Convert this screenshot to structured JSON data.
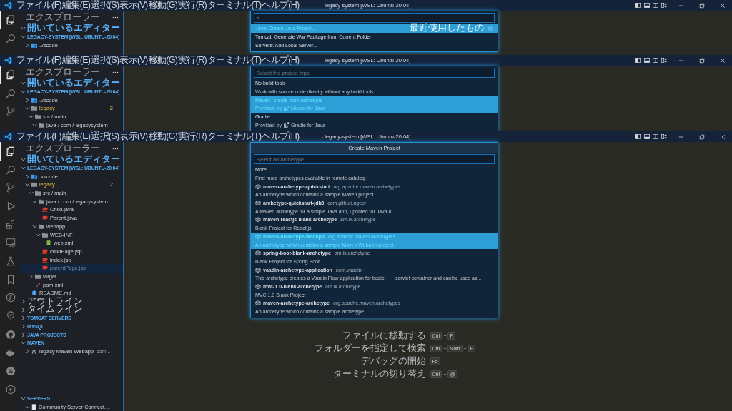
{
  "windows": [
    {
      "title": "- legacy-system [WSL: Ubuntu-20.04]",
      "menu": [
        "ファイル(F)",
        "編集(E)",
        "選択(S)",
        "表示(V)",
        "移動(G)",
        "実行(R)",
        "ターミナル(T)",
        "ヘルプ(H)"
      ],
      "explorer_title": "エクスプローラー",
      "sections": [
        {
          "title": "開いているエディター",
          "kind": "editors",
          "expanded": true
        },
        {
          "title": "LEGACY-SYSTEM [WSL: UBUNTU-20.04]",
          "kind": "workspace",
          "expanded": true,
          "items": [
            {
              "label": ".vscode",
              "kind": "vscode-folder",
              "expanded": false,
              "selected": false
            }
          ]
        }
      ],
      "quick_pick": {
        "value": ">",
        "items": [
          {
            "kind": "command",
            "label": "Java: Create Java Project...",
            "tag": "最近使用したもの",
            "selected": true
          },
          {
            "kind": "command",
            "label": "Tomcat: Generate War Package from Current Folder",
            "selected": false
          },
          {
            "kind": "command",
            "label": "Servers: Add Local Server...",
            "selected": false
          }
        ]
      }
    },
    {
      "title": "- legacy-system [WSL: Ubuntu-20.04]",
      "menu": [
        "ファイル(F)",
        "編集(E)",
        "選択(S)",
        "表示(V)",
        "移動(G)",
        "実行(R)",
        "ターミナル(T)",
        "ヘルプ(H)"
      ],
      "explorer_title": "エクスプローラー",
      "sections": [
        {
          "title": "開いているエディター",
          "kind": "editors",
          "expanded": true
        },
        {
          "title": "LEGACY-SYSTEM [WSL: UBUNTU-20.04]",
          "kind": "workspace",
          "expanded": true,
          "items": [
            {
              "label": ".vscode",
              "kind": "vscode-folder",
              "expanded": false,
              "selected": false
            },
            {
              "label": "legacy",
              "kind": "folder",
              "expanded": true,
              "selected": false,
              "badge": "2",
              "children": [
                {
                  "label": "src / main",
                  "kind": "folder",
                  "expanded": true,
                  "selected": false,
                  "children": [
                    {
                      "label": "java / com / legacysystem",
                      "kind": "folder",
                      "expanded": true,
                      "selected": false
                    }
                  ]
                }
              ]
            }
          ]
        }
      ],
      "quick_pick": {
        "placeholder": "Select the project type",
        "items": [
          {
            "kind": "option",
            "label": "No build tools",
            "detail": "Work with source code directly without any build tools",
            "selected": false
          },
          {
            "kind": "option",
            "label": "Maven",
            "description": "create from archetype",
            "detail": "Provided by",
            "provider": "Maven for Java",
            "selected": true
          },
          {
            "kind": "option",
            "label": "Gradle",
            "detail": "Provided by",
            "provider": "Gradle for Java",
            "selected": false
          }
        ]
      }
    },
    {
      "title": "- legacy-system [WSL: Ubuntu-20.04]",
      "menu": [
        "ファイル(F)",
        "編集(E)",
        "選択(S)",
        "表示(V)",
        "移動(G)",
        "実行(R)",
        "ターミナル(T)",
        "ヘルプ(H)"
      ],
      "explorer_title": "エクスプローラー",
      "sections": [
        {
          "title": "開いているエディター",
          "kind": "editors",
          "expanded": true
        },
        {
          "title": "LEGACY-SYSTEM [WSL: UBUNTU-20.04]",
          "kind": "workspace",
          "expanded": true,
          "items": [
            {
              "label": ".vscode",
              "kind": "vscode-folder",
              "expanded": false,
              "selected": false
            },
            {
              "label": "legacy",
              "kind": "folder",
              "expanded": true,
              "selected": false,
              "badge": "2",
              "children": [
                {
                  "label": "src / main",
                  "kind": "folder",
                  "expanded": true,
                  "selected": false,
                  "children": [
                    {
                      "label": "java / com / legacysystem",
                      "kind": "folder",
                      "expanded": true,
                      "selected": false,
                      "children": [
                        {
                          "label": "Child.java",
                          "kind": "java",
                          "selected": false
                        },
                        {
                          "label": "Parent.java",
                          "kind": "java",
                          "selected": false
                        }
                      ]
                    },
                    {
                      "label": "webapp",
                      "kind": "folder",
                      "expanded": true,
                      "selected": false,
                      "children": [
                        {
                          "label": "WEB-INF",
                          "kind": "folder",
                          "expanded": true,
                          "selected": false,
                          "children": [
                            {
                              "label": "web.xml",
                              "kind": "xml",
                              "selected": false
                            }
                          ]
                        },
                        {
                          "label": "childPage.jsp",
                          "kind": "java",
                          "selected": false
                        },
                        {
                          "label": "index.jsp",
                          "kind": "java",
                          "selected": false
                        },
                        {
                          "label": "parentPage.jsp",
                          "kind": "java",
                          "selected": true
                        }
                      ]
                    }
                  ]
                },
                {
                  "label": "target",
                  "kind": "folder",
                  "expanded": false,
                  "selected": false
                },
                {
                  "label": "pom.xml",
                  "kind": "pom",
                  "selected": false
                }
              ]
            },
            {
              "label": "README.md",
              "kind": "info",
              "selected": false
            }
          ]
        },
        {
          "title": "アウトライン",
          "kind": "builtin",
          "expanded": false
        },
        {
          "title": "タイムライン",
          "kind": "builtin",
          "expanded": false
        },
        {
          "title": "TOMCAT SERVERS",
          "kind": "extension",
          "expanded": false
        },
        {
          "title": "MYSQL",
          "kind": "extension",
          "expanded": false
        },
        {
          "title": "JAVA PROJECTS",
          "kind": "extension",
          "expanded": false
        },
        {
          "title": "MAVEN",
          "kind": "extension",
          "expanded": true,
          "items": [
            {
              "label": "legacy Maven Webapp",
              "description": "com...",
              "kind": "maven",
              "expanded": false,
              "selected": false
            }
          ]
        },
        {
          "title": "SERVERS",
          "kind": "extension",
          "expanded": true,
          "items": [
            {
              "label": "Community Server Connect...",
              "kind": "server",
              "expanded": true,
              "selected": false
            }
          ]
        }
      ],
      "quick_pick": {
        "title": "Create Maven Project",
        "placeholder": "Select an archetype ...",
        "items": [
          {
            "kind": "more",
            "label": "More...",
            "detail": "Find more archetypes available in remote catalog.",
            "selected": false
          },
          {
            "kind": "archetype",
            "label": "maven-archetype-quickstart",
            "description": "org.apache.maven.archetypes",
            "detail": "An archetype which contains a sample Maven project.",
            "selected": false
          },
          {
            "kind": "archetype",
            "label": "archetype-quickstart-jdk8",
            "description": "com.github.ngeor",
            "detail": "A Maven archetype for a simple Java app, updated for Java 8",
            "selected": false
          },
          {
            "kind": "archetype",
            "label": "maven-reactjs-blank-archetype",
            "description": "am.ik.archetype",
            "detail": "Blank Project for React.js",
            "selected": false
          },
          {
            "kind": "archetype",
            "label": "maven-archetype-webapp",
            "description": "org.apache.maven.archetypes",
            "detail": "An archetype which contains a sample Maven Webapp project.",
            "selected": true
          },
          {
            "kind": "archetype",
            "label": "spring-boot-blank-archetype",
            "description": "am.ik.archetype",
            "detail": "Blank Project for Spring Boot",
            "selected": false
          },
          {
            "kind": "archetype",
            "label": "vaadin-archetype-application",
            "description": "com.vaadin",
            "detail": "This archetype creates a Vaadin Flow application for basic        servlet container and can be used as...",
            "selected": false
          },
          {
            "kind": "archetype",
            "label": "mvc-1.0-blank-archetype",
            "description": "am.ik.archetype",
            "detail": "MVC 1.0 Blank Project",
            "selected": false
          },
          {
            "kind": "archetype",
            "label": "maven-archetype-archetype",
            "description": "org.apache.maven.archetypes",
            "detail": "An archetype which contains a sample archetype.",
            "selected": false
          }
        ]
      },
      "hints": [
        {
          "label": "ファイルに移動する",
          "keys": [
            "Ctrl",
            "+",
            "P"
          ]
        },
        {
          "label": "フォルダーを指定して検索",
          "keys": [
            "Ctrl",
            "+",
            "Shift",
            "+",
            "F"
          ]
        },
        {
          "label": "デバッグの開始",
          "keys": [
            "F5"
          ]
        },
        {
          "label": "ターミナルの切り替え",
          "keys": [
            "Ctrl",
            "+",
            "@"
          ]
        }
      ]
    }
  ]
}
